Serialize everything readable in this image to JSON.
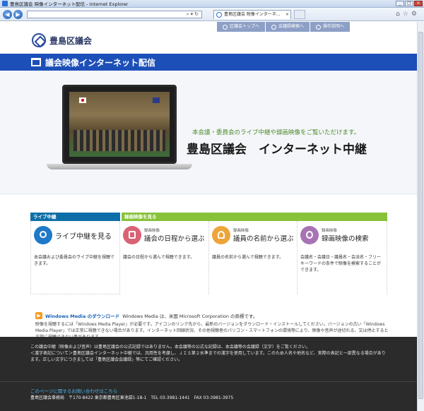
{
  "window": {
    "title": "豊島区議会 映像インターネット配信 - Internet Explorer",
    "tab_title": "豊島区議会 映像インターネ...",
    "tab_close": "×",
    "min": "_",
    "max": "□",
    "close": "×"
  },
  "top_nav": [
    {
      "label": "区議会トップへ"
    },
    {
      "label": "会議録検索へ"
    },
    {
      "label": "操作説明へ"
    }
  ],
  "logo_text": "豊島区議会",
  "banner_title": "議会映像インターネット配信",
  "hero": {
    "subtitle": "本会議・委員会のライブ中継や録画映像をご覧いただけます。",
    "title": "豊島区議会　インターネット中継"
  },
  "sections": {
    "live": "ライブ中継",
    "recorded": "録画映像を見る"
  },
  "cards": [
    {
      "small": "",
      "title": "ライブ中継を見る",
      "desc": "本会議および委員会のライブ中継を視聴できます。"
    },
    {
      "small": "録画映像",
      "title": "議会の日程から選ぶ",
      "desc": "議会の日程から選んで視聴できます。"
    },
    {
      "small": "録画映像",
      "title": "議員の名前から選ぶ",
      "desc": "議員の名前から選んで視聴できます。"
    },
    {
      "small": "録画映像",
      "title": "録画映像の検索",
      "desc": "会議名・会議日・議員名・会派名・フリーキーワードの条件で映像を検索することができます。"
    }
  ],
  "media": {
    "link": "Windows Media のダウンロード",
    "trademark": "Windows Media は、米国 Microsoft Corporation の商標です。",
    "body": "映像を視聴するには「Windows Media Player」が必要です。アイコンのリンク先から、最新のバージョンをダウンロード・インストールしてください。バージョンの古い「Windows Media Player」では正常に視聴できない場合があります。インターネット回線状況、その他視聴者のパソコン・スマートフォンの環境等により、映像や音声が途切れる、又は停止すると正常に視聴できない事があります。"
  },
  "footer": {
    "note1": "この議会中継（映像および音声）は豊島区議会の公式記録ではありません。本会議等の公式な記録は、本会議等の会議録（文字）をご覧ください。",
    "note2": "＜漢字表記について＞豊島区議会インターネット中継では、汎用性を考慮し、ＪＩＳ第２水準までの漢字を使用しています。このため人名や地名など、実際の表記と一部異なる場合があります。正しい文字につきましては「豊島区議会会議録」等にてご確認ください。",
    "contact": "このページに関するお問い合わせはこちら",
    "address": "豊島区議会事務局　〒170-8422 東京都豊島区東池袋1-18-1　TEL 03-3981-1441　FAX 03-3981-3975"
  },
  "colors": {
    "banner": "#1c4fb8",
    "live_header": "#0e6fa8",
    "recorded_header": "#88c23a",
    "footer_bg": "#2b2b2b"
  }
}
